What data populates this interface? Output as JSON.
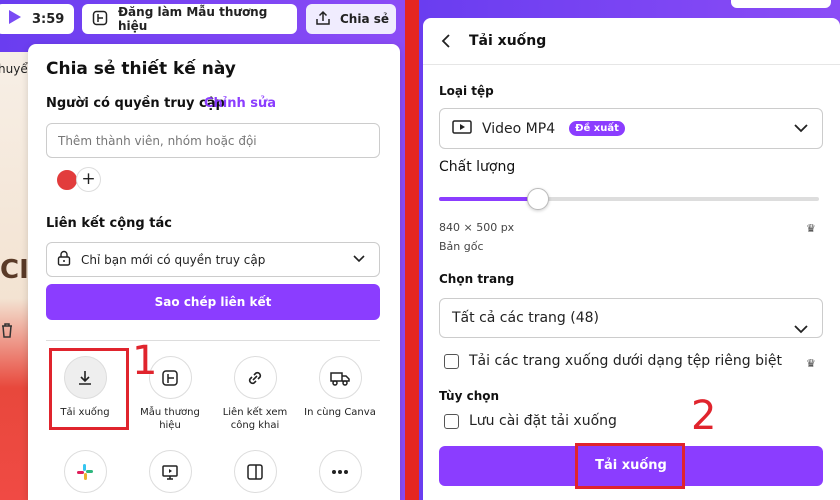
{
  "topbar": {
    "play_time": "3:59",
    "brand_button": "Đăng làm Mẫu thương hiệu",
    "share_button": "Chia sẻ"
  },
  "canvas": {
    "fragment_text": "huyể",
    "fragment_big": "CI"
  },
  "share_panel": {
    "title": "Chia sẻ thiết kế này",
    "access_label": "Người có quyền truy cập",
    "edit_link": "Chỉnh sửa",
    "member_placeholder": "Thêm thành viên, nhóm hoặc đội",
    "collab_label": "Liên kết cộng tác",
    "link_access": "Chỉ bạn mới có quyền truy cập",
    "copy_button": "Sao chép liên kết",
    "options": [
      {
        "label": "Tải xuống",
        "icon": "download-icon"
      },
      {
        "label": "Mẫu thương hiệu",
        "icon": "brand-template-icon"
      },
      {
        "label": "Liên kết xem công khai",
        "icon": "link-icon"
      },
      {
        "label": "In cùng Canva",
        "icon": "truck-icon"
      }
    ],
    "more_icons": [
      "slack-icon",
      "present-icon",
      "layout-icon",
      "more-icon"
    ]
  },
  "annotations": {
    "step1": "1",
    "step2": "2",
    "highlight_color": "#e0242d"
  },
  "download_panel": {
    "title": "Tải xuống",
    "file_type_label": "Loại tệp",
    "file_type_value": "Video MP4",
    "recommended_badge": "Đề xuất",
    "quality_label": "Chất lượng",
    "quality_level_fraction": 0.26,
    "size_text": "840 × 500 px",
    "original_text": "Bản gốc",
    "page_label": "Chọn trang",
    "page_value": "Tất cả các trang (48)",
    "separate_files_label": "Tải các trang xuống dưới dạng tệp riêng biệt",
    "options_label": "Tùy chọn",
    "save_settings_label": "Lưu cài đặt tải xuống",
    "download_button": "Tải xuống"
  },
  "colors": {
    "accent": "#8b3dff",
    "divider_red": "#e52620"
  }
}
